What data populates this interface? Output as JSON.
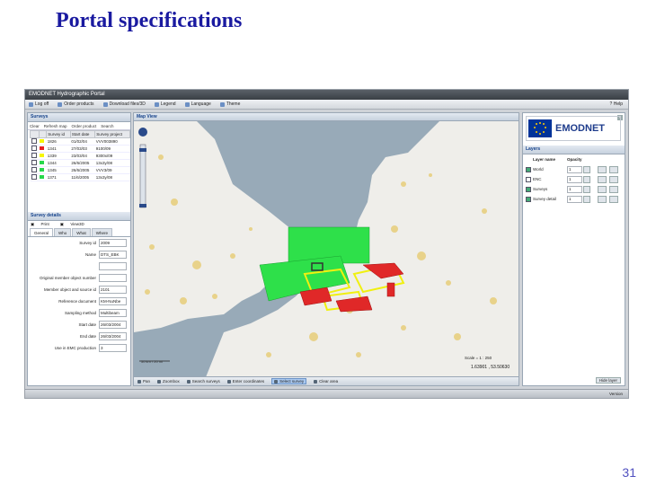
{
  "slide": {
    "title": "Portal specifications",
    "page_number": "31"
  },
  "app": {
    "window_title": "EMODNET Hydrographic Portal"
  },
  "menu": {
    "items": [
      "Log off",
      "Order products",
      "Download files/3D",
      "Legend",
      "Language",
      "Theme"
    ],
    "help": "Help"
  },
  "surveys": {
    "title": "Surveys",
    "tools": [
      "Clear",
      "Refresh map",
      "Order product",
      "Search"
    ],
    "columns": [
      "",
      "",
      "Survey id",
      "Start date",
      "Survey project"
    ],
    "rows": [
      {
        "color": "#f6f600",
        "id": "1826",
        "start": "01/02/04",
        "project": "VVV003890"
      },
      {
        "color": "#e82020",
        "id": "1341",
        "start": "27/03/03",
        "project": "9100/09"
      },
      {
        "color": "#f6f600",
        "id": "1339",
        "start": "23/03/04",
        "project": "9300x/09"
      },
      {
        "color": "#27d84a",
        "id": "1344",
        "start": "26/6/2005",
        "project": "13x3y/08"
      },
      {
        "color": "#27d84a",
        "id": "1345",
        "start": "26/6/2005",
        "project": "VVV3/09"
      },
      {
        "color": "#27d84a",
        "id": "1371",
        "start": "11/6/2005",
        "project": "13x3y/08"
      }
    ]
  },
  "details": {
    "title": "Survey details",
    "tools": [
      "Print",
      "View3D"
    ],
    "tabs": [
      "General",
      "Who",
      "What",
      "Where"
    ],
    "fields": [
      {
        "label": "Survey id",
        "value": "2009"
      },
      {
        "label": "Name",
        "value": "DTS_EBK"
      },
      {
        "label": "",
        "value": ""
      },
      {
        "label": "Original member object number",
        "value": ""
      },
      {
        "label": "Member object and source id",
        "value": "2101"
      },
      {
        "label": "Reference document",
        "value": "KM-NuNbe"
      },
      {
        "label": "Sampling method",
        "value": "Multibeam"
      },
      {
        "label": "Start date",
        "value": "26/03/2004"
      },
      {
        "label": "End date",
        "value": "26/03/2004"
      },
      {
        "label": "Use in EMC production",
        "value": "3"
      }
    ]
  },
  "map": {
    "title": "Map View",
    "scale": "Scale = 1 : 250",
    "coords": "1.63901 , 53.50630",
    "scalebar": [
      "50 km",
      "20 mi"
    ],
    "bottom_tools": [
      "Pan",
      "Zoombox",
      "Search surveys",
      "Enter coordinates",
      "Select survey",
      "Clear area"
    ],
    "selected_tool": "Select survey",
    "colors": {
      "sea": "#98aab8",
      "land": "#efeeea",
      "urban": "#e8d28a",
      "yellow": "#f0f010",
      "red": "#e02828",
      "green": "#2ee04a"
    }
  },
  "layers": {
    "logo_text": "EMODNET",
    "title": "Layers",
    "header": {
      "name": "Layer name",
      "opacity": "Opacity"
    },
    "items": [
      {
        "checked": true,
        "name": "World",
        "opacity": "1"
      },
      {
        "checked": false,
        "name": "ENC",
        "opacity": "1"
      },
      {
        "checked": true,
        "name": "Surveys",
        "opacity": "1"
      },
      {
        "checked": true,
        "name": "Survey detail",
        "opacity": "1"
      }
    ],
    "hide_button": "Hide layer"
  },
  "status": {
    "right_text": "Version"
  }
}
